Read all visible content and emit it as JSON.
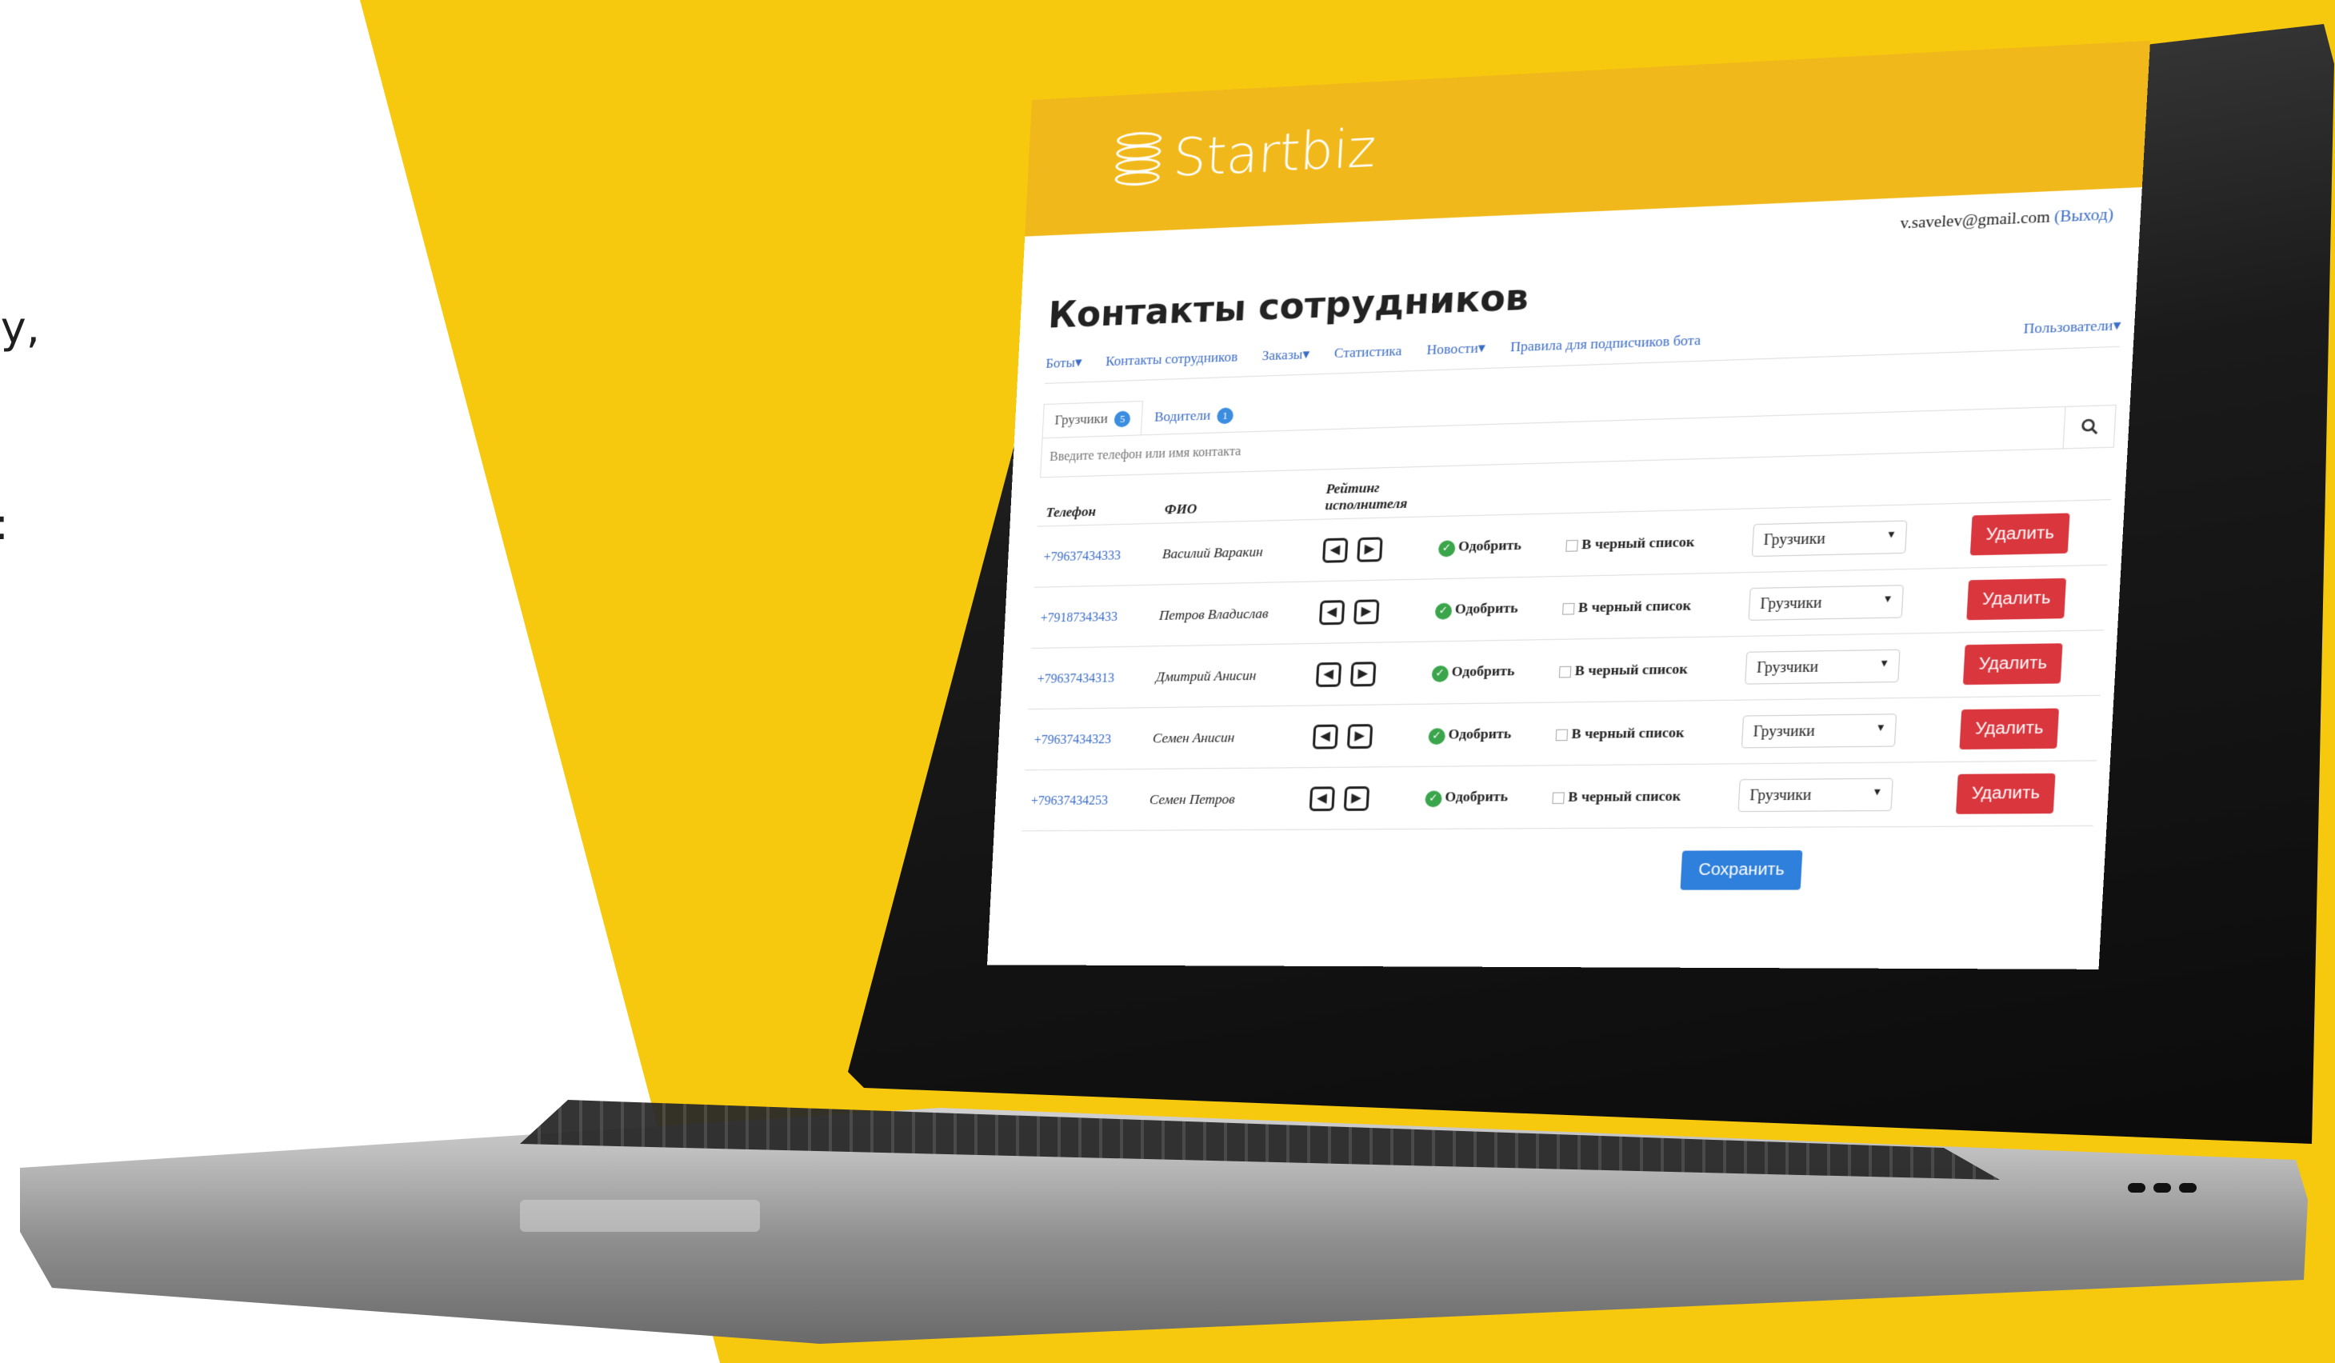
{
  "promo": {
    "line1": "му,",
    "line2": "са:"
  },
  "app": {
    "brand": "Startbiz",
    "user_email": "v.savelev@gmail.com",
    "logout_label": "(Выход)",
    "page_title": "Контакты сотрудников"
  },
  "nav": {
    "bots": "Боты▾",
    "contacts": "Контакты сотрудников",
    "orders": "Заказы▾",
    "stats": "Статистика",
    "news": "Новости▾",
    "rules": "Правила для подписчиков бота",
    "users": "Пользователи▾"
  },
  "tabs": [
    {
      "label": "Грузчики",
      "count": "5"
    },
    {
      "label": "Водители",
      "count": "1"
    }
  ],
  "search": {
    "placeholder": "Введите телефон или имя контакта"
  },
  "table": {
    "headers": {
      "phone": "Телефон",
      "name": "ФИО",
      "rating": "Рейтинг исполнителя"
    },
    "approve_label": "Одобрить",
    "blacklist_label": "В черный список",
    "delete_label": "Удалить",
    "rows": [
      {
        "phone": "+79637434333",
        "name": "Василий Варакин",
        "group": "Грузчики"
      },
      {
        "phone": "+79187343433",
        "name": "Петров Владислав",
        "group": "Грузчики"
      },
      {
        "phone": "+79637434313",
        "name": "Дмитрий Анисин",
        "group": "Грузчики"
      },
      {
        "phone": "+79637434323",
        "name": "Семен Анисин",
        "group": "Грузчики"
      },
      {
        "phone": "+79637434253",
        "name": "Семен Петров",
        "group": "Грузчики"
      }
    ]
  },
  "save_label": "Сохранить",
  "colors": {
    "yellow": "#f6c80e",
    "header_yellow": "#f0b81a",
    "link_blue": "#3b6cc4",
    "delete_red": "#d9363e",
    "save_blue": "#2f7fdc",
    "approve_green": "#3aa54a"
  }
}
